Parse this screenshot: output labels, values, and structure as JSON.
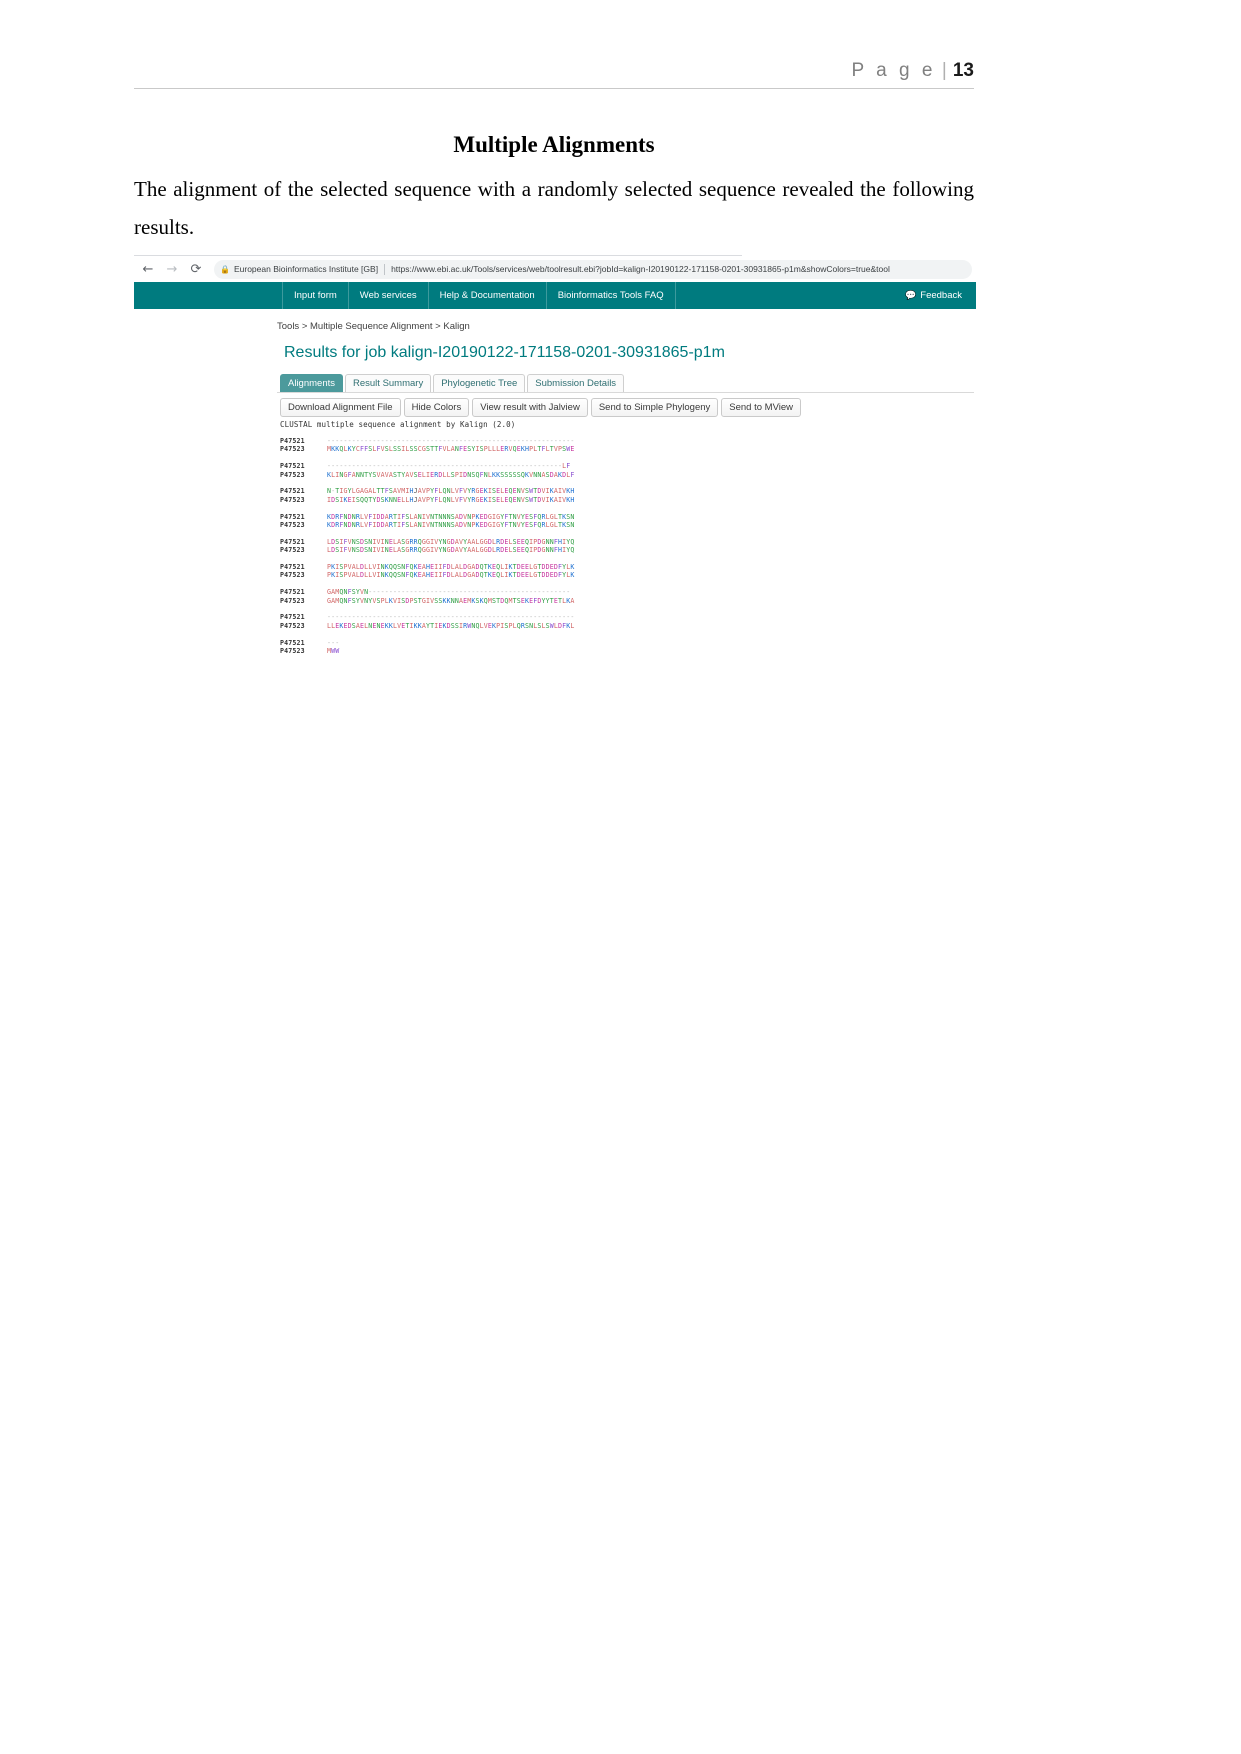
{
  "document": {
    "header": {
      "page_word": "P a g e",
      "separator": "|",
      "page_number": "13"
    },
    "title": "Multiple Alignments",
    "paragraph": "The alignment of the selected sequence with a randomly selected sequence revealed the following results."
  },
  "browser": {
    "back_icon": "arrow-left-icon",
    "forward_icon": "arrow-right-icon",
    "reload_icon": "reload-icon",
    "lock_icon": "lock-icon",
    "site_identity": "European Bioinformatics Institute [GB]",
    "url": "https://www.ebi.ac.uk/Tools/services/web/toolresult.ebi?jobId=kalign-I20190122-171158-0201-30931865-p1m&showColors=true&tool"
  },
  "site_nav": {
    "items": [
      {
        "label": "Input form"
      },
      {
        "label": "Web services"
      },
      {
        "label": "Help & Documentation"
      },
      {
        "label": "Bioinformatics Tools FAQ"
      }
    ],
    "feedback": {
      "label": "Feedback",
      "icon": "speech-bubble-icon"
    },
    "background_color": "#007b7f"
  },
  "page_content": {
    "breadcrumb": "Tools > Multiple Sequence Alignment > Kalign",
    "results_title": "Results for job kalign-I20190122-171158-0201-30931865-p1m",
    "accent_color": "#007b7f",
    "tabs": [
      {
        "label": "Alignments",
        "active": true
      },
      {
        "label": "Result Summary",
        "active": false
      },
      {
        "label": "Phylogenetic Tree",
        "active": false
      },
      {
        "label": "Submission Details",
        "active": false
      }
    ],
    "actions": [
      {
        "label": "Download Alignment File"
      },
      {
        "label": "Hide Colors"
      },
      {
        "label": "View result with Jalview"
      },
      {
        "label": "Send to Simple Phylogeny"
      },
      {
        "label": "Send to MView"
      }
    ],
    "clustal_header": "CLUSTAL multiple sequence alignment by Kalign (2.0)",
    "sequence_ids": [
      "P47521",
      "P47523"
    ],
    "alignment_blocks": [
      {
        "rows": [
          {
            "id": "P47521",
            "seq": "------------------------------------------------------------"
          },
          {
            "id": "P47523",
            "seq": "MKKQLKYCFFSLFVSLSSILSSCGSTTFVLANFESYISPLLLERVQEKHPLTFLTVPSWE"
          }
        ]
      },
      {
        "rows": [
          {
            "id": "P47521",
            "seq": "---------------------------------------------------------LF"
          },
          {
            "id": "P47523",
            "seq": "KLINGFANNTYSVAVASTYAVSELIERDLLSPIDNSQFNLKKSSSSSQKVNNASDAKDLF"
          }
        ]
      },
      {
        "rows": [
          {
            "id": "P47521",
            "seq": "N-TIGYLGAGALTTFSAVMIHJAVPYFLQNLVFVYRGEKISELEQENVSWTDVIKAIVKH"
          },
          {
            "id": "P47523",
            "seq": "IDSIKEISQQTYDSKNNELLHJAVPYFLQNLVFVYRGEKISELEQENVSWTDVIKAIVKH"
          }
        ]
      },
      {
        "rows": [
          {
            "id": "P47521",
            "seq": "KDRFNDNRLVFIDDARTIFSLANIVNTNNNSADVNPKEDGIGYFTNVYESFQRLGLTKSN"
          },
          {
            "id": "P47523",
            "seq": "KDRFNDNRLVFIDDARTIFSLANIVNTNNNSADVNPKEDGIGYFTNVYESFQRLGLTKSN"
          }
        ]
      },
      {
        "rows": [
          {
            "id": "P47521",
            "seq": "LDSIFVNSDSNIVINELASGRRQGGIVYNGDAVYAALGGDLRDELSEEQIPDGNNFHIYQ"
          },
          {
            "id": "P47523",
            "seq": "LDSIFVNSDSNIVINELASGRRQGGIVYNGDAVYAALGGDLRDELSEEQIPDGNNFHIYQ"
          }
        ]
      },
      {
        "rows": [
          {
            "id": "P47521",
            "seq": "PKISPVALDLLVINKQQSNFQKEAHEIIFDLALDGADQTKEQLIKTDEELGTDDEDFYLK"
          },
          {
            "id": "P47523",
            "seq": "PKISPVALDLLVINKQQSNFQKEAHEIIFDLALDGADQTKEQLIKTDEELGTDDEDFYLK"
          }
        ]
      },
      {
        "rows": [
          {
            "id": "P47521",
            "seq": "GAMQNFSYVN-------------------------------------------------"
          },
          {
            "id": "P47523",
            "seq": "GAMQNFSYVNYVSPLKVISDPSTGIVSSKKNNAEMKSKQMSTDQMTSEKEFDYYTETLKA"
          }
        ]
      },
      {
        "rows": [
          {
            "id": "P47521",
            "seq": "------------------------------------------------------------"
          },
          {
            "id": "P47523",
            "seq": "LLEKEDSAELNENEKKLVETIKKAYTIEKDSSIRWNQLVEKPISPLQRSNLSLSWLDFKL"
          }
        ]
      },
      {
        "rows": [
          {
            "id": "P47521",
            "seq": "---"
          },
          {
            "id": "P47523",
            "seq": "MWW"
          }
        ]
      }
    ],
    "residue_colors": {
      "hydrophobic": "#d16666",
      "polar": "#2f9e44",
      "basic": "#1c6fd0",
      "acidic": "#c838a0",
      "aromatic": "#8a4fd0",
      "gap": "#b8b8b8"
    }
  }
}
